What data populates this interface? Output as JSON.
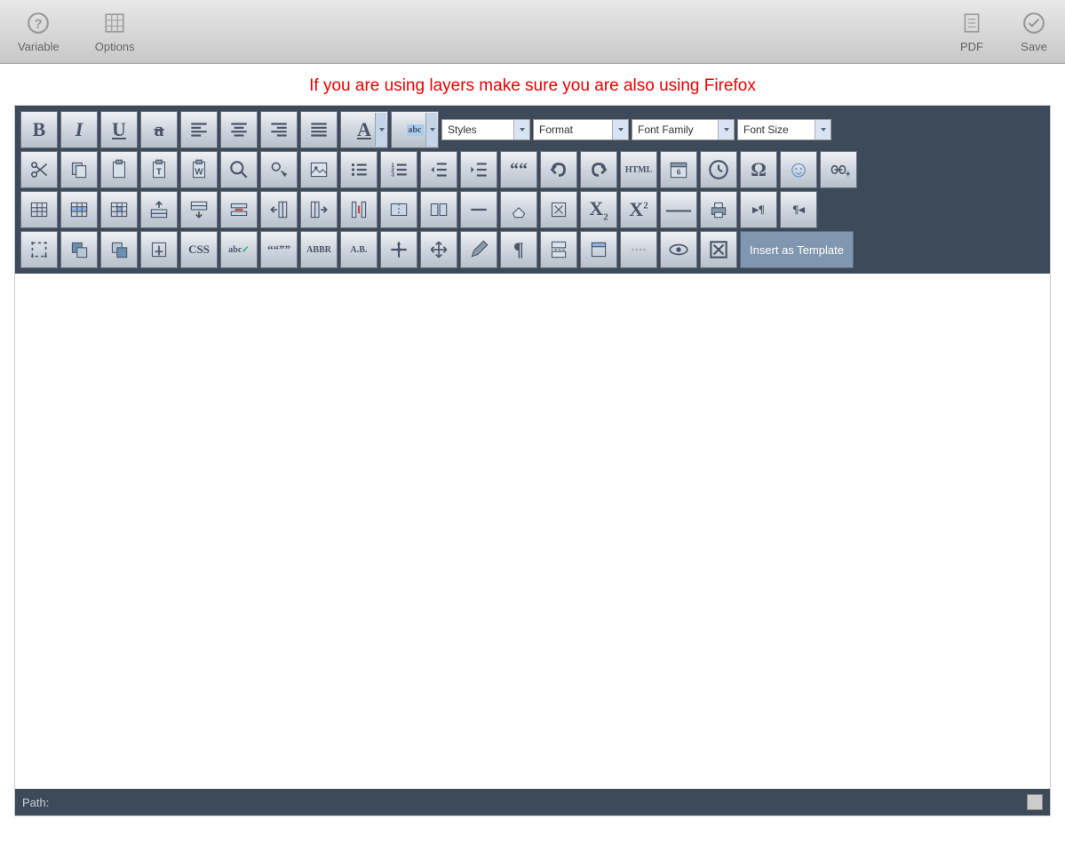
{
  "toolbar": {
    "variable": "Variable",
    "options": "Options",
    "pdf": "PDF",
    "save": "Save"
  },
  "warning": "If you are using layers make sure you are also using Firefox",
  "editor": {
    "row1": {
      "bold": "B",
      "italic": "I",
      "underline": "U",
      "strike": "S",
      "align_left": "align-left",
      "align_center": "align-center",
      "align_right": "align-right",
      "align_justify": "align-justify",
      "text_color": "A",
      "highlight": "abc"
    },
    "selects": {
      "styles": "Styles",
      "format": "Format",
      "font_family": "Font Family",
      "font_size": "Font Size"
    },
    "row2": {
      "cut": "cut",
      "copy": "copy",
      "paste": "paste",
      "paste_text": "T",
      "paste_word": "W",
      "find": "find",
      "replace": "replace",
      "image": "image",
      "bullet": "bullet",
      "numbered": "numbered",
      "outdent": "outdent",
      "indent": "indent",
      "blockquote": "““",
      "undo": "undo",
      "redo": "redo",
      "html": "HTML",
      "date": "date",
      "time": "time",
      "special_char": "Ω",
      "smiley": "☺",
      "link": "link"
    },
    "row3": {
      "table": "table",
      "row_props": "row",
      "cell_props": "cell",
      "insert_row_before": "row-before",
      "insert_row_after": "row-after",
      "delete_row": "del-row",
      "insert_col_before": "col-before",
      "insert_col_after": "col-after",
      "delete_col": "del-col",
      "split_cells": "split",
      "merge_cells": "merge",
      "hr": "hr",
      "remove_format": "eraser",
      "cleanup": "cleanup",
      "subscript": "X",
      "sub_small": "2",
      "superscript": "X",
      "sup_small": "2",
      "strikethrough": "—",
      "print": "print",
      "ltr": "▸¶",
      "rtl": "¶◂"
    },
    "row4": {
      "fullscreen": "fullscreen",
      "layer_back": "back",
      "layer_front": "front",
      "anchor": "anchor",
      "css": "CSS",
      "spellcheck": "abc✓",
      "quotes": "““””",
      "abbr": "ABBR",
      "acronym": "A.B.",
      "insert_layer": "layer",
      "move_layer": "move",
      "edit": "edit",
      "pilcrow": "¶",
      "pagebreak": "pagebreak",
      "template": "template",
      "nbsp": "nbsp",
      "preview": "preview",
      "full": "full",
      "insert_template": "Insert as Template"
    }
  },
  "status": {
    "path_label": "Path:"
  }
}
